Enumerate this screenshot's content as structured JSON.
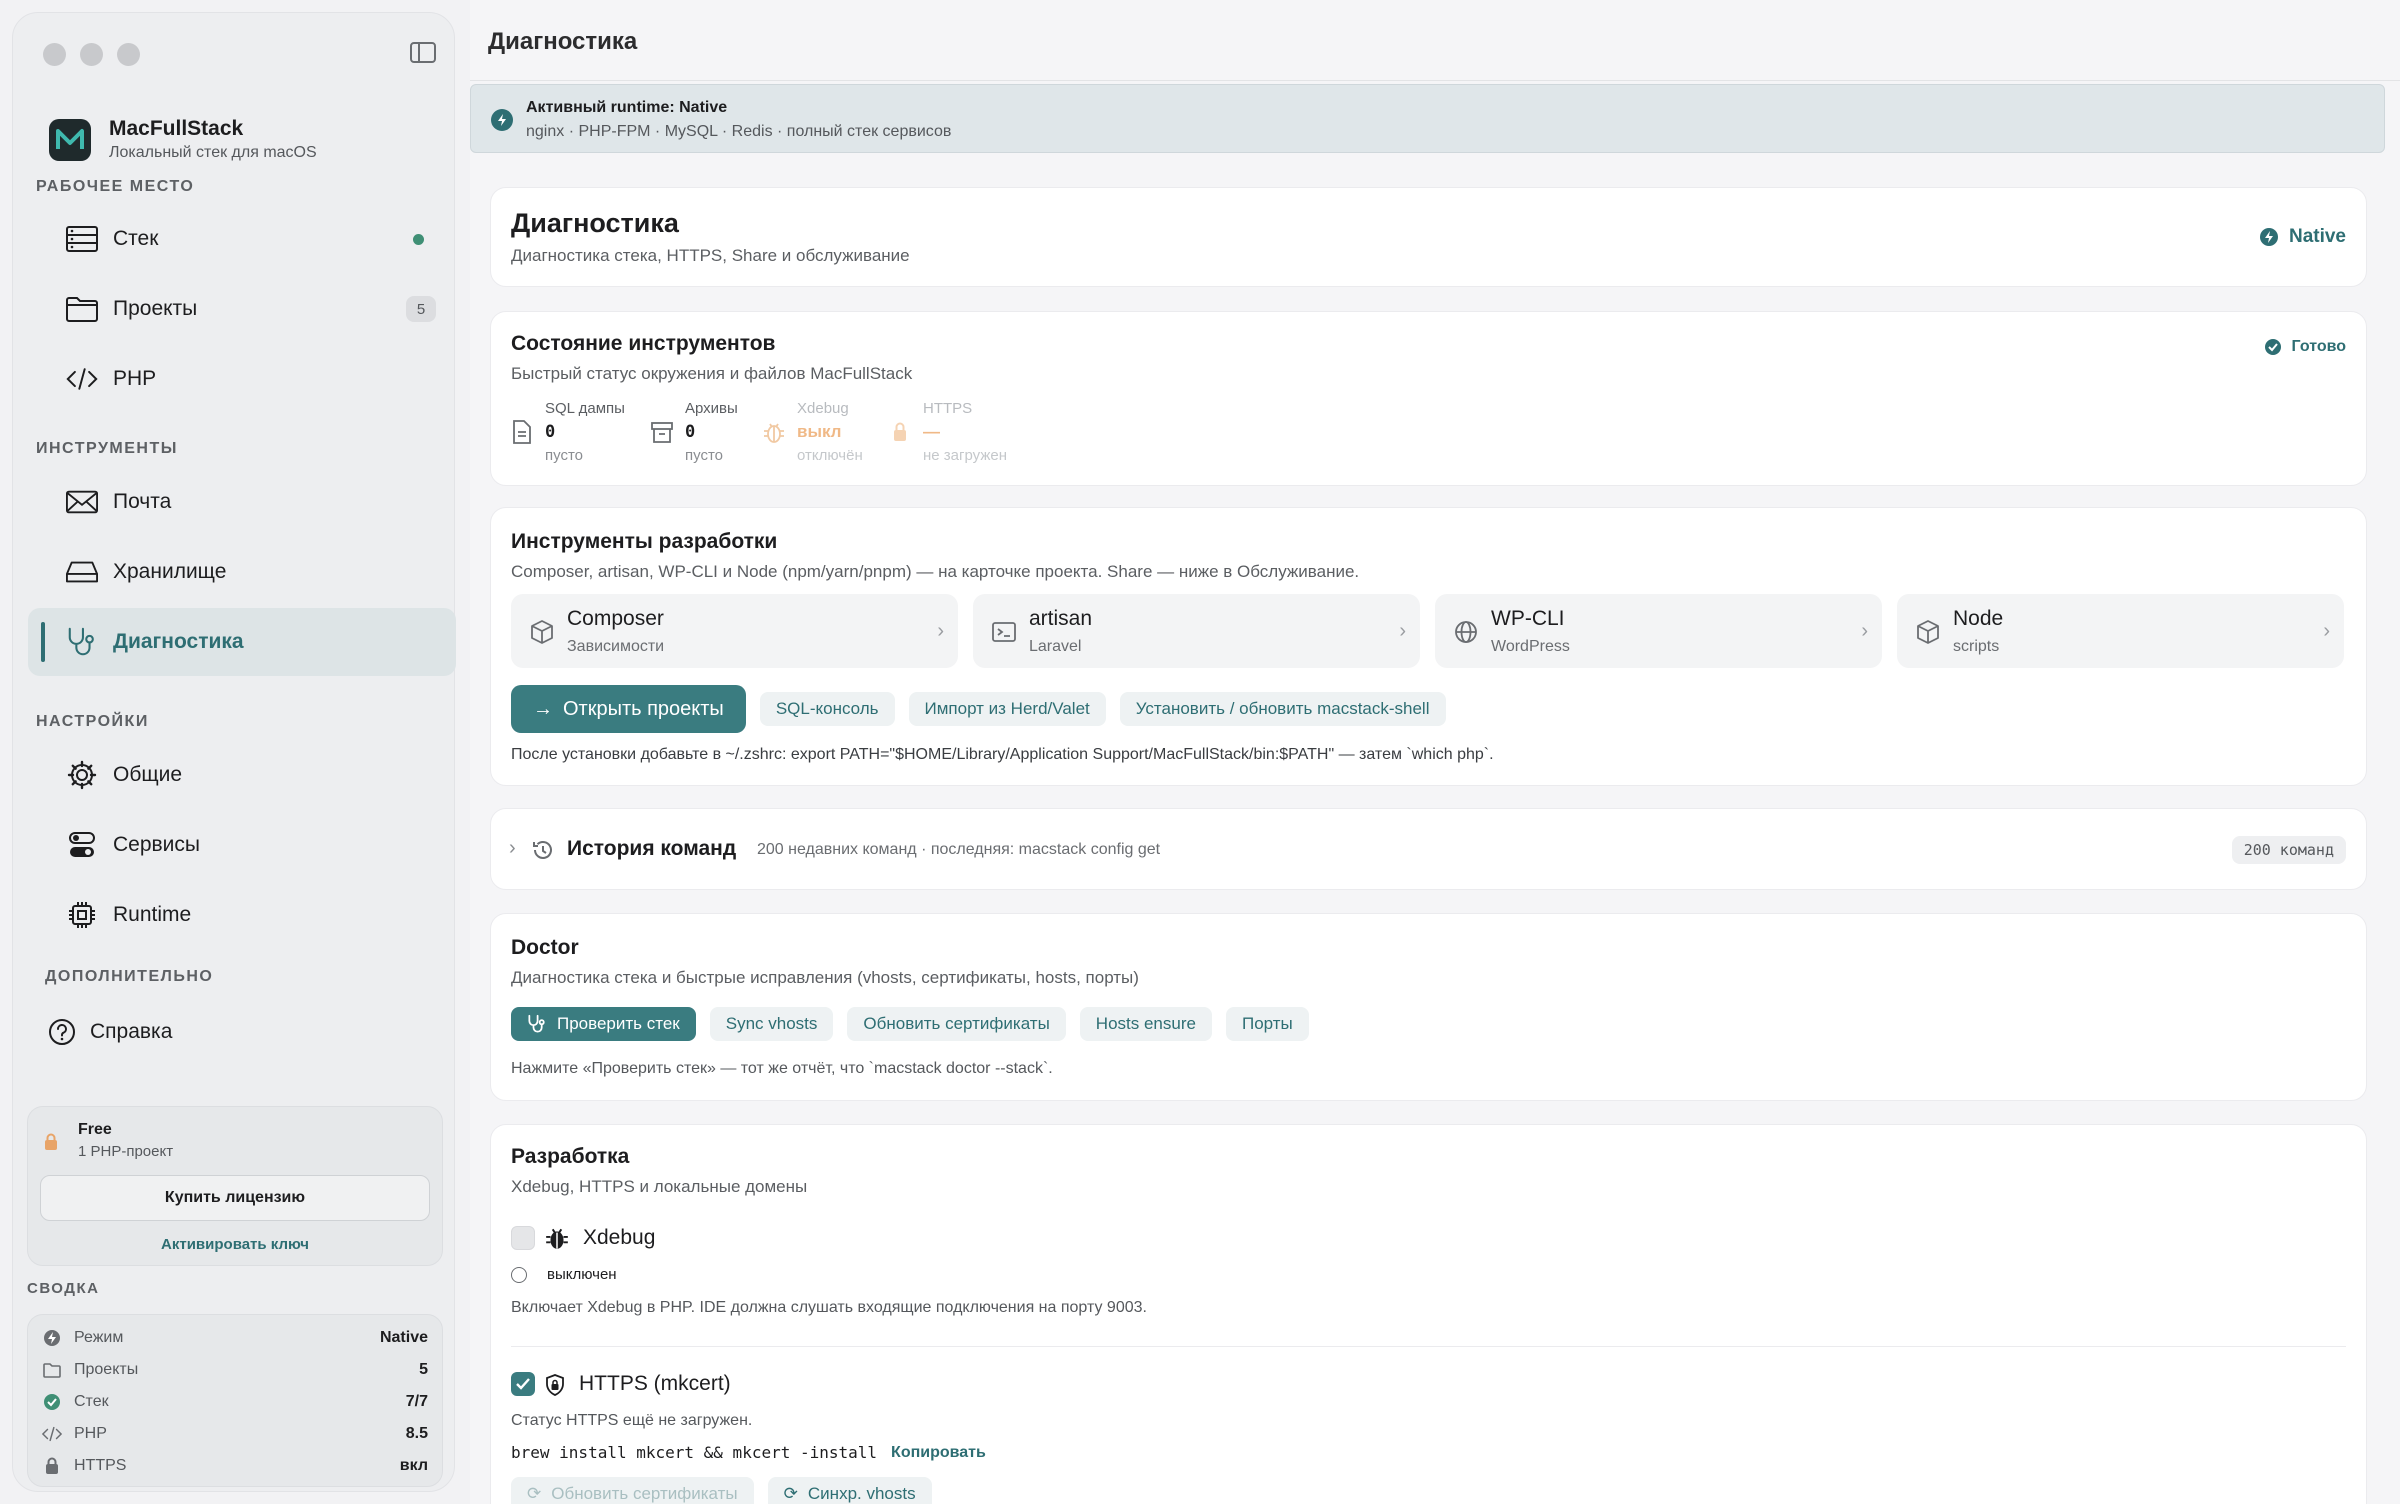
{
  "window": {
    "title": "Диагностика"
  },
  "brand": {
    "name": "MacFullStack",
    "subtitle": "Локальный стек для macOS"
  },
  "sidebar": {
    "sections": {
      "workspace": "РАБОЧЕЕ МЕСТО",
      "tools": "ИНСТРУМЕНТЫ",
      "settings": "НАСТРОЙКИ",
      "extra": "ДОПОЛНИТЕЛЬНО"
    },
    "items": [
      {
        "label": "Стек",
        "icon": "server-icon",
        "status": "online"
      },
      {
        "label": "Проекты",
        "icon": "folder-icon",
        "badge": "5"
      },
      {
        "label": "PHP",
        "icon": "code-icon"
      },
      {
        "label": "Почта",
        "icon": "mail-icon"
      },
      {
        "label": "Хранилище",
        "icon": "drive-icon"
      },
      {
        "label": "Диагностика",
        "icon": "stethoscope-icon",
        "active": true
      },
      {
        "label": "Общие",
        "icon": "gear-icon"
      },
      {
        "label": "Сервисы",
        "icon": "toggles-icon"
      },
      {
        "label": "Runtime",
        "icon": "cpu-icon"
      },
      {
        "label": "Справка",
        "icon": "help-icon"
      }
    ],
    "license": {
      "plan": "Free",
      "limit": "1 PHP-проект",
      "buy_label": "Купить лицензию",
      "activate_label": "Активировать ключ"
    },
    "summary": {
      "title": "СВОДКА",
      "rows": [
        {
          "label": "Режим",
          "value": "Native",
          "icon": "bolt-icon"
        },
        {
          "label": "Проекты",
          "value": "5",
          "icon": "folder-icon"
        },
        {
          "label": "Стек",
          "value": "7/7",
          "icon": "check-circle-icon"
        },
        {
          "label": "PHP",
          "value": "8.5",
          "icon": "code-icon"
        },
        {
          "label": "HTTPS",
          "value": "вкл",
          "icon": "lock-icon"
        }
      ]
    }
  },
  "banner": {
    "title": "Активный runtime: Native",
    "subtitle": "nginx · PHP-FPM · MySQL · Redis · полный стек сервисов"
  },
  "header_card": {
    "title": "Диагностика",
    "subtitle": "Диагностика стека, HTTPS, Share и обслуживание",
    "runtime_badge": "Native"
  },
  "tools_state": {
    "title": "Состояние инструментов",
    "subtitle": "Быстрый статус окружения и файлов MacFullStack",
    "status": "Готово",
    "stats": [
      {
        "label": "SQL дампы",
        "value": "0",
        "sub": "пусто",
        "icon": "document-icon",
        "accent": "#1d1d1f"
      },
      {
        "label": "Архивы",
        "value": "0",
        "sub": "пусто",
        "icon": "archive-icon",
        "accent": "#1d1d1f"
      },
      {
        "label": "Xdebug",
        "value": "выкл",
        "sub": "отключён",
        "icon": "bug-icon",
        "accent": "#e8a468"
      },
      {
        "label": "HTTPS",
        "value": "—",
        "sub": "не загружен",
        "icon": "lock-icon",
        "accent": "#e8a468"
      }
    ]
  },
  "dev_tools": {
    "title": "Инструменты разработки",
    "subtitle": "Composer, artisan, WP-CLI и Node (npm/yarn/pnpm) — на карточке проекта. Share — ниже в Обслуживание.",
    "tools": [
      {
        "name": "Composer",
        "sub": "Зависимости",
        "icon": "cube-icon"
      },
      {
        "name": "artisan",
        "sub": "Laravel",
        "icon": "terminal-icon"
      },
      {
        "name": "WP-CLI",
        "sub": "WordPress",
        "icon": "globe-icon"
      },
      {
        "name": "Node",
        "sub": "scripts",
        "icon": "cube-icon"
      }
    ],
    "actions": {
      "open_projects": "Открыть проекты",
      "sql_console": "SQL-консоль",
      "import": "Импорт из Herd/Valet",
      "install_shell": "Установить / обновить macstack-shell"
    },
    "note": "После установки добавьте в ~/.zshrc: export PATH=\"$HOME/Library/Application Support/MacFullStack/bin:$PATH\" — затем `which php`."
  },
  "history": {
    "title": "История команд",
    "subtitle": "200 недавних команд · последняя: macstack config get",
    "count": "200 команд"
  },
  "doctor": {
    "title": "Doctor",
    "subtitle": "Диагностика стека и быстрые исправления (vhosts, сертификаты, hosts, порты)",
    "actions": {
      "check": "Проверить стек",
      "sync": "Sync vhosts",
      "certs": "Обновить сертификаты",
      "hosts": "Hosts ensure",
      "ports": "Порты"
    },
    "note": "Нажмите «Проверить стек» — тот же отчёт, что `macstack doctor --stack`."
  },
  "development": {
    "title": "Разработка",
    "subtitle": "Xdebug, HTTPS и локальные домены",
    "xdebug": {
      "label": "Xdebug",
      "state": "выключен",
      "desc": "Включает Xdebug в PHP. IDE должна слушать входящие подключения на порту 9003."
    },
    "https": {
      "label": "HTTPS (mkcert)",
      "status": "Статус HTTPS ещё не загружен.",
      "command": "brew install mkcert && mkcert -install",
      "copy_label": "Копировать",
      "refresh_label": "Обновить сертификаты",
      "sync_label": "Синхр. vhosts"
    }
  },
  "colors": {
    "accent": "#2e6e73",
    "accent_button": "#3a7c80",
    "status_green": "#3f8f75",
    "warning": "#e8a468"
  }
}
